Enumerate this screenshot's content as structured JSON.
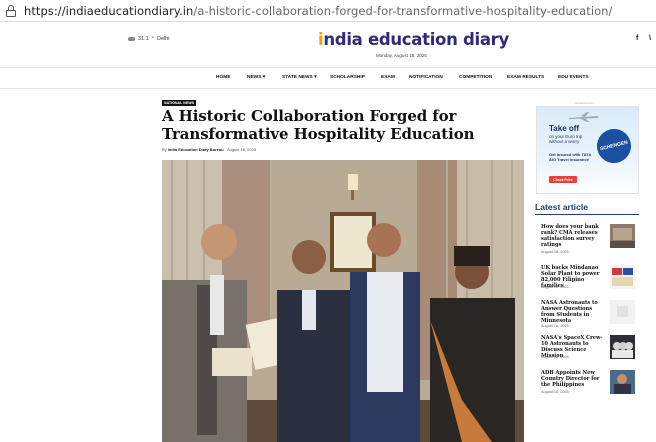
{
  "browser": {
    "url_host": "https://indiaeducationdiary.in",
    "url_path": "/a-historic-collaboration-forged-for-transformative-hospitality-education/"
  },
  "header": {
    "weather_temp": "31.1",
    "weather_unit": "°",
    "weather_city": "Delhi",
    "logo_i": "i",
    "logo_rest": "ndia education diary",
    "date": "Monday, August 18, 2025",
    "social_facebook": "f",
    "social_twitter": "\\"
  },
  "nav": {
    "items": [
      "HOME",
      "NEWS",
      "STATE NEWS",
      "SCHOLARSHIP",
      "EXAM",
      "NOTIFICATION",
      "COMPETITION",
      "EXAM RESULTS",
      "EDU EVENTS"
    ],
    "dropdown_indicator": "▾"
  },
  "article": {
    "category": "NATIONAL NEWS",
    "title": "A Historic Collaboration Forged for Transformative Hospitality Education",
    "by_prefix": "By",
    "author": "India Education Diary Bureau",
    "date": "August 18, 2025"
  },
  "ad": {
    "label": "- Advertisement -",
    "headline": "Take off",
    "subline": "on your Euro trip without a worry",
    "insurance": "Get insured with TATA AIG Travel Insurance",
    "cta": "Check Price",
    "stamp": "SCHENGEN"
  },
  "sidebar": {
    "heading": "Latest article",
    "articles": [
      {
        "title": "How does your bank rank? CMA releases satisfaction survey ratings",
        "date": "August 18, 2025"
      },
      {
        "title": "UK backs Mindanao Solar Plant to power 82,000 Filipino families",
        "date": "August 18, 2025"
      },
      {
        "title": "NASA Astronauts to Answer Questions from Students in Minnesota",
        "date": "August 18, 2025"
      },
      {
        "title": "NASA's SpaceX Crew-10 Astronauts to Discuss Science Mission",
        "date": "August 18, 2025"
      },
      {
        "title": "ADB Appoints New Country Director for the Philippines",
        "date": "August 18, 2025"
      }
    ]
  },
  "colors": {
    "brand": "#2f2a7a",
    "accent": "#f1a400",
    "link_heading": "#1d3e7a"
  }
}
